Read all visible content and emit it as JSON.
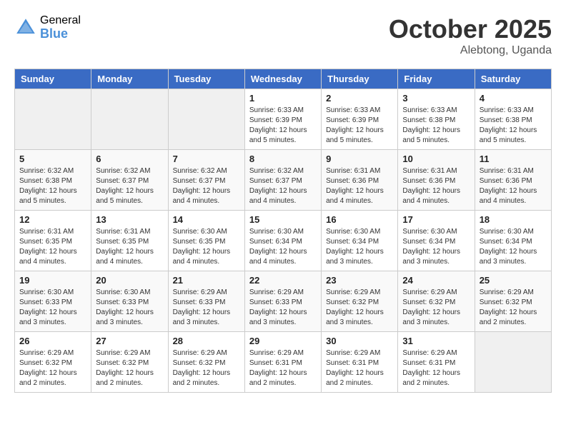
{
  "header": {
    "logo_general": "General",
    "logo_blue": "Blue",
    "month": "October 2025",
    "location": "Alebtong, Uganda"
  },
  "days_of_week": [
    "Sunday",
    "Monday",
    "Tuesday",
    "Wednesday",
    "Thursday",
    "Friday",
    "Saturday"
  ],
  "weeks": [
    [
      {
        "day": "",
        "info": ""
      },
      {
        "day": "",
        "info": ""
      },
      {
        "day": "",
        "info": ""
      },
      {
        "day": "1",
        "info": "Sunrise: 6:33 AM\nSunset: 6:39 PM\nDaylight: 12 hours\nand 5 minutes."
      },
      {
        "day": "2",
        "info": "Sunrise: 6:33 AM\nSunset: 6:39 PM\nDaylight: 12 hours\nand 5 minutes."
      },
      {
        "day": "3",
        "info": "Sunrise: 6:33 AM\nSunset: 6:38 PM\nDaylight: 12 hours\nand 5 minutes."
      },
      {
        "day": "4",
        "info": "Sunrise: 6:33 AM\nSunset: 6:38 PM\nDaylight: 12 hours\nand 5 minutes."
      }
    ],
    [
      {
        "day": "5",
        "info": "Sunrise: 6:32 AM\nSunset: 6:38 PM\nDaylight: 12 hours\nand 5 minutes."
      },
      {
        "day": "6",
        "info": "Sunrise: 6:32 AM\nSunset: 6:37 PM\nDaylight: 12 hours\nand 5 minutes."
      },
      {
        "day": "7",
        "info": "Sunrise: 6:32 AM\nSunset: 6:37 PM\nDaylight: 12 hours\nand 4 minutes."
      },
      {
        "day": "8",
        "info": "Sunrise: 6:32 AM\nSunset: 6:37 PM\nDaylight: 12 hours\nand 4 minutes."
      },
      {
        "day": "9",
        "info": "Sunrise: 6:31 AM\nSunset: 6:36 PM\nDaylight: 12 hours\nand 4 minutes."
      },
      {
        "day": "10",
        "info": "Sunrise: 6:31 AM\nSunset: 6:36 PM\nDaylight: 12 hours\nand 4 minutes."
      },
      {
        "day": "11",
        "info": "Sunrise: 6:31 AM\nSunset: 6:36 PM\nDaylight: 12 hours\nand 4 minutes."
      }
    ],
    [
      {
        "day": "12",
        "info": "Sunrise: 6:31 AM\nSunset: 6:35 PM\nDaylight: 12 hours\nand 4 minutes."
      },
      {
        "day": "13",
        "info": "Sunrise: 6:31 AM\nSunset: 6:35 PM\nDaylight: 12 hours\nand 4 minutes."
      },
      {
        "day": "14",
        "info": "Sunrise: 6:30 AM\nSunset: 6:35 PM\nDaylight: 12 hours\nand 4 minutes."
      },
      {
        "day": "15",
        "info": "Sunrise: 6:30 AM\nSunset: 6:34 PM\nDaylight: 12 hours\nand 4 minutes."
      },
      {
        "day": "16",
        "info": "Sunrise: 6:30 AM\nSunset: 6:34 PM\nDaylight: 12 hours\nand 3 minutes."
      },
      {
        "day": "17",
        "info": "Sunrise: 6:30 AM\nSunset: 6:34 PM\nDaylight: 12 hours\nand 3 minutes."
      },
      {
        "day": "18",
        "info": "Sunrise: 6:30 AM\nSunset: 6:34 PM\nDaylight: 12 hours\nand 3 minutes."
      }
    ],
    [
      {
        "day": "19",
        "info": "Sunrise: 6:30 AM\nSunset: 6:33 PM\nDaylight: 12 hours\nand 3 minutes."
      },
      {
        "day": "20",
        "info": "Sunrise: 6:30 AM\nSunset: 6:33 PM\nDaylight: 12 hours\nand 3 minutes."
      },
      {
        "day": "21",
        "info": "Sunrise: 6:29 AM\nSunset: 6:33 PM\nDaylight: 12 hours\nand 3 minutes."
      },
      {
        "day": "22",
        "info": "Sunrise: 6:29 AM\nSunset: 6:33 PM\nDaylight: 12 hours\nand 3 minutes."
      },
      {
        "day": "23",
        "info": "Sunrise: 6:29 AM\nSunset: 6:32 PM\nDaylight: 12 hours\nand 3 minutes."
      },
      {
        "day": "24",
        "info": "Sunrise: 6:29 AM\nSunset: 6:32 PM\nDaylight: 12 hours\nand 3 minutes."
      },
      {
        "day": "25",
        "info": "Sunrise: 6:29 AM\nSunset: 6:32 PM\nDaylight: 12 hours\nand 2 minutes."
      }
    ],
    [
      {
        "day": "26",
        "info": "Sunrise: 6:29 AM\nSunset: 6:32 PM\nDaylight: 12 hours\nand 2 minutes."
      },
      {
        "day": "27",
        "info": "Sunrise: 6:29 AM\nSunset: 6:32 PM\nDaylight: 12 hours\nand 2 minutes."
      },
      {
        "day": "28",
        "info": "Sunrise: 6:29 AM\nSunset: 6:32 PM\nDaylight: 12 hours\nand 2 minutes."
      },
      {
        "day": "29",
        "info": "Sunrise: 6:29 AM\nSunset: 6:31 PM\nDaylight: 12 hours\nand 2 minutes."
      },
      {
        "day": "30",
        "info": "Sunrise: 6:29 AM\nSunset: 6:31 PM\nDaylight: 12 hours\nand 2 minutes."
      },
      {
        "day": "31",
        "info": "Sunrise: 6:29 AM\nSunset: 6:31 PM\nDaylight: 12 hours\nand 2 minutes."
      },
      {
        "day": "",
        "info": ""
      }
    ]
  ]
}
